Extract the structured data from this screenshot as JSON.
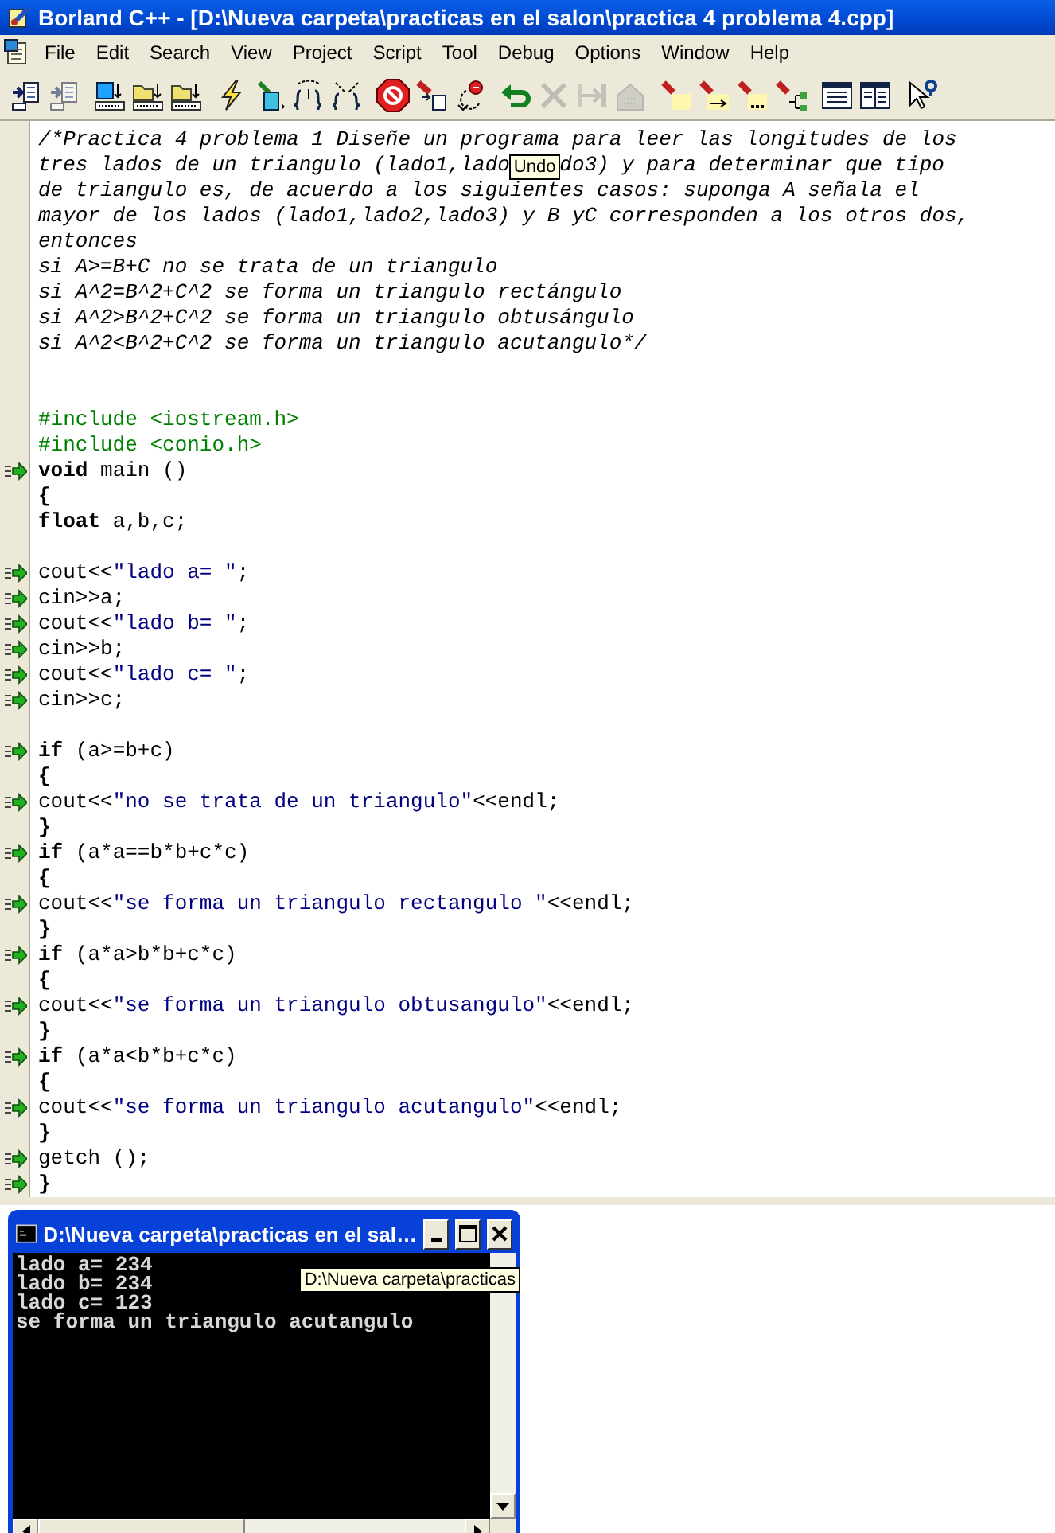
{
  "window": {
    "title": "Borland C++ - [D:\\Nueva carpeta\\practicas en el salon\\practica 4 problema 4.cpp]"
  },
  "menu": [
    "File",
    "Edit",
    "Search",
    "View",
    "Project",
    "Script",
    "Tool",
    "Debug",
    "Options",
    "Window",
    "Help"
  ],
  "toolbar": [
    [
      {
        "kind": "doc-arrow",
        "disabled": false
      },
      {
        "kind": "doc-arrow",
        "disabled": true
      }
    ],
    [
      {
        "kind": "binary-blue",
        "disabled": false
      },
      {
        "kind": "binary-yellow",
        "disabled": false
      },
      {
        "kind": "binary-yellow",
        "disabled": false
      }
    ],
    [
      {
        "kind": "lightning",
        "disabled": false
      },
      {
        "kind": "brush",
        "disabled": false
      },
      {
        "kind": "brace-in",
        "disabled": false
      },
      {
        "kind": "brace-out",
        "disabled": false
      }
    ],
    [
      {
        "kind": "stop",
        "disabled": false
      },
      {
        "kind": "flash-doc",
        "disabled": false
      },
      {
        "kind": "reset",
        "disabled": false
      }
    ],
    [
      {
        "kind": "undo",
        "disabled": false
      },
      {
        "kind": "cut",
        "disabled": true
      },
      {
        "kind": "step",
        "disabled": true
      },
      {
        "kind": "house",
        "disabled": true
      }
    ],
    [
      {
        "kind": "flash",
        "disabled": false
      },
      {
        "kind": "flash-ab",
        "disabled": false
      },
      {
        "kind": "flash-dots",
        "disabled": false
      },
      {
        "kind": "flash-tree",
        "disabled": false
      }
    ],
    [
      {
        "kind": "window",
        "disabled": false
      },
      {
        "kind": "window-split",
        "disabled": false
      }
    ],
    [
      {
        "kind": "help",
        "disabled": false
      }
    ]
  ],
  "editor": {
    "lines": [
      {
        "marker": false,
        "tokens": [
          {
            "kind": "comment",
            "text": "/*Practica 4 problema 1 Diseñe un programa para leer las longitudes de los"
          }
        ]
      },
      {
        "marker": false,
        "tokens": [
          {
            "kind": "comment",
            "text": "tres lados de un triangulo (lado1,lado"
          },
          {
            "kind": "tooltip",
            "text": "Undo"
          },
          {
            "kind": "comment",
            "text": "do3) y para determinar que tipo"
          }
        ]
      },
      {
        "marker": false,
        "tokens": [
          {
            "kind": "comment",
            "text": "de triangulo es, de acuerdo a los siguientes casos: suponga A señala el"
          }
        ]
      },
      {
        "marker": false,
        "tokens": [
          {
            "kind": "comment",
            "text": "mayor de los lados (lado1,lado2,lado3) y B yC corresponden a los otros dos,"
          }
        ]
      },
      {
        "marker": false,
        "tokens": [
          {
            "kind": "comment",
            "text": "entonces"
          }
        ]
      },
      {
        "marker": false,
        "tokens": [
          {
            "kind": "comment",
            "text": "si A>=B+C no se trata de un triangulo"
          }
        ]
      },
      {
        "marker": false,
        "tokens": [
          {
            "kind": "comment",
            "text": "si A^2=B^2+C^2 se forma un triangulo rectángulo"
          }
        ]
      },
      {
        "marker": false,
        "tokens": [
          {
            "kind": "comment",
            "text": "si A^2>B^2+C^2 se forma un triangulo obtusángulo"
          }
        ]
      },
      {
        "marker": false,
        "tokens": [
          {
            "kind": "comment",
            "text": "si A^2<B^2+C^2 se forma un triangulo acutangulo*/"
          }
        ]
      },
      {
        "marker": false
      },
      {
        "marker": false
      },
      {
        "marker": false,
        "tokens": [
          {
            "kind": "preprocessor",
            "text": "#include <iostream.h>"
          }
        ]
      },
      {
        "marker": false,
        "tokens": [
          {
            "kind": "preprocessor",
            "text": "#include <conio.h>"
          }
        ]
      },
      {
        "marker": true,
        "tokens": [
          {
            "kind": "keyword",
            "text": "void"
          },
          {
            "kind": "plain",
            "text": " main ()"
          }
        ]
      },
      {
        "marker": false,
        "tokens": [
          {
            "kind": "symbol",
            "text": "{"
          }
        ]
      },
      {
        "marker": false,
        "tokens": [
          {
            "kind": "keyword",
            "text": "float"
          },
          {
            "kind": "plain",
            "text": " a,b,c;"
          }
        ]
      },
      {
        "marker": false
      },
      {
        "marker": true,
        "tokens": [
          {
            "kind": "plain",
            "text": "cout<<"
          },
          {
            "kind": "string",
            "text": "\"lado a= \""
          },
          {
            "kind": "plain",
            "text": ";"
          }
        ]
      },
      {
        "marker": true,
        "tokens": [
          {
            "kind": "plain",
            "text": "cin>>a;"
          }
        ]
      },
      {
        "marker": true,
        "tokens": [
          {
            "kind": "plain",
            "text": "cout<<"
          },
          {
            "kind": "string",
            "text": "\"lado b= \""
          },
          {
            "kind": "plain",
            "text": ";"
          }
        ]
      },
      {
        "marker": true,
        "tokens": [
          {
            "kind": "plain",
            "text": "cin>>b;"
          }
        ]
      },
      {
        "marker": true,
        "tokens": [
          {
            "kind": "plain",
            "text": "cout<<"
          },
          {
            "kind": "string",
            "text": "\"lado c= \""
          },
          {
            "kind": "plain",
            "text": ";"
          }
        ]
      },
      {
        "marker": true,
        "tokens": [
          {
            "kind": "plain",
            "text": "cin>>c;"
          }
        ]
      },
      {
        "marker": false
      },
      {
        "marker": true,
        "tokens": [
          {
            "kind": "keyword",
            "text": "if"
          },
          {
            "kind": "plain",
            "text": " (a>=b+c)"
          }
        ]
      },
      {
        "marker": false,
        "tokens": [
          {
            "kind": "symbol",
            "text": "{"
          }
        ]
      },
      {
        "marker": true,
        "tokens": [
          {
            "kind": "plain",
            "text": "cout<<"
          },
          {
            "kind": "string",
            "text": "\"no se trata de un triangulo\""
          },
          {
            "kind": "plain",
            "text": "<<endl;"
          }
        ]
      },
      {
        "marker": false,
        "tokens": [
          {
            "kind": "symbol",
            "text": "}"
          }
        ]
      },
      {
        "marker": true,
        "tokens": [
          {
            "kind": "keyword",
            "text": "if"
          },
          {
            "kind": "plain",
            "text": " (a*a==b*b+c*c)"
          }
        ]
      },
      {
        "marker": false,
        "tokens": [
          {
            "kind": "symbol",
            "text": "{"
          }
        ]
      },
      {
        "marker": true,
        "tokens": [
          {
            "kind": "plain",
            "text": "cout<<"
          },
          {
            "kind": "string",
            "text": "\"se forma un triangulo rectangulo \""
          },
          {
            "kind": "plain",
            "text": "<<endl;"
          }
        ]
      },
      {
        "marker": false,
        "tokens": [
          {
            "kind": "symbol",
            "text": "}"
          }
        ]
      },
      {
        "marker": true,
        "tokens": [
          {
            "kind": "keyword",
            "text": "if"
          },
          {
            "kind": "plain",
            "text": " (a*a>b*b+c*c)"
          }
        ]
      },
      {
        "marker": false,
        "tokens": [
          {
            "kind": "symbol",
            "text": "{"
          }
        ]
      },
      {
        "marker": true,
        "tokens": [
          {
            "kind": "plain",
            "text": "cout<<"
          },
          {
            "kind": "string",
            "text": "\"se forma un triangulo obtusangulo\""
          },
          {
            "kind": "plain",
            "text": "<<endl;"
          }
        ]
      },
      {
        "marker": false,
        "tokens": [
          {
            "kind": "symbol",
            "text": "}"
          }
        ]
      },
      {
        "marker": true,
        "tokens": [
          {
            "kind": "keyword",
            "text": "if"
          },
          {
            "kind": "plain",
            "text": " (a*a<b*b+c*c)"
          }
        ]
      },
      {
        "marker": false,
        "tokens": [
          {
            "kind": "symbol",
            "text": "{"
          }
        ]
      },
      {
        "marker": true,
        "tokens": [
          {
            "kind": "plain",
            "text": "cout<<"
          },
          {
            "kind": "string",
            "text": "\"se forma un triangulo acutangulo\""
          },
          {
            "kind": "plain",
            "text": "<<endl;"
          }
        ]
      },
      {
        "marker": false,
        "tokens": [
          {
            "kind": "symbol",
            "text": "}"
          }
        ]
      },
      {
        "marker": true,
        "tokens": [
          {
            "kind": "plain",
            "text": "getch ();"
          }
        ]
      },
      {
        "marker": true,
        "tokens": [
          {
            "kind": "symbol",
            "text": "}"
          }
        ]
      }
    ]
  },
  "console": {
    "title": "D:\\Nueva carpeta\\practicas en el sal…",
    "output": [
      "lado a= 234",
      "lado b= 234",
      "lado c= 123",
      "se forma un triangulo acutangulo"
    ],
    "tooltip": "D:\\Nueva carpeta\\practicas"
  }
}
